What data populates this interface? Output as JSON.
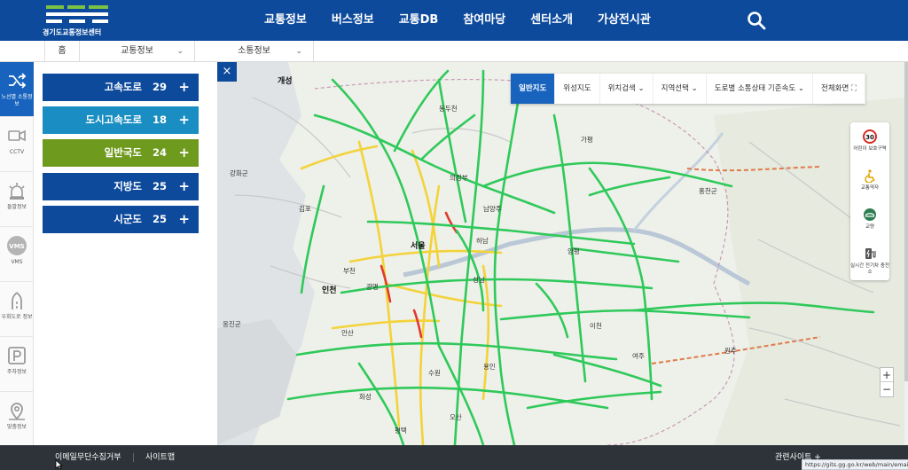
{
  "header": {
    "logo_text": "경기도교통정보센터",
    "nav": [
      "교통정보",
      "버스정보",
      "교통DB",
      "참여마당",
      "센터소개",
      "가상전시관"
    ]
  },
  "breadcrumb": {
    "home": "홈",
    "level1": "교통정보",
    "level2": "소통정보"
  },
  "rail": [
    {
      "label": "노선별 소통정보",
      "icon": "route-shuffle-icon"
    },
    {
      "label": "CCTV",
      "icon": "cctv-icon"
    },
    {
      "label": "돌발정보",
      "icon": "alert-light-icon"
    },
    {
      "label": "VMS",
      "icon": "vms-icon"
    },
    {
      "label": "우회도로 정보",
      "icon": "detour-road-icon"
    },
    {
      "label": "주차정보",
      "icon": "parking-icon"
    },
    {
      "label": "맞춤정보",
      "icon": "location-pin-icon"
    }
  ],
  "roads": [
    {
      "name": "고속도로",
      "count": "29",
      "color": "#0d4a9c"
    },
    {
      "name": "도시고속도로",
      "count": "18",
      "color": "#1a8ec2"
    },
    {
      "name": "일반국도",
      "count": "24",
      "color": "#6e9a1e"
    },
    {
      "name": "지방도",
      "count": "25",
      "color": "#0d4a9c"
    },
    {
      "name": "시군도",
      "count": "25",
      "color": "#0d4a9c"
    }
  ],
  "map": {
    "close": "×",
    "tools": [
      "일반지도",
      "위성지도",
      "위치검색",
      "지역선택",
      "도로별 소통상태 기준속도",
      "전체화면"
    ],
    "legend": [
      {
        "label": "어린이 보호구역",
        "icon": "speed-limit-icon"
      },
      {
        "label": "교통약자",
        "icon": "wheelchair-icon"
      },
      {
        "label": "교량",
        "icon": "bridge-icon"
      },
      {
        "label": "실시간 전기차 충전소",
        "icon": "ev-charger-icon"
      }
    ],
    "legend_badge": "30",
    "places": [
      {
        "t": "개성",
        "big": true
      },
      {
        "t": "동두천"
      },
      {
        "t": "포천"
      },
      {
        "t": "의정부"
      },
      {
        "t": "서울",
        "big": true
      },
      {
        "t": "인천",
        "big": true
      },
      {
        "t": "부천"
      },
      {
        "t": "수원"
      },
      {
        "t": "용인"
      },
      {
        "t": "이천"
      },
      {
        "t": "여주"
      },
      {
        "t": "원주"
      },
      {
        "t": "홍천군"
      },
      {
        "t": "양평"
      },
      {
        "t": "강화군"
      },
      {
        "t": "김포"
      },
      {
        "t": "광명"
      },
      {
        "t": "안산"
      },
      {
        "t": "평택"
      },
      {
        "t": "오산"
      },
      {
        "t": "하남"
      },
      {
        "t": "성남"
      },
      {
        "t": "남양주"
      },
      {
        "t": "가평"
      },
      {
        "t": "옹진군"
      },
      {
        "t": "화성"
      }
    ],
    "zoom_in": "+",
    "zoom_out": "−"
  },
  "footer": {
    "email_refusal": "이메일무단수집거부",
    "sitemap": "사이트맵",
    "related": "관련사이트"
  },
  "status_url": "https://gits.gg.go.kr/web/main/email.do"
}
